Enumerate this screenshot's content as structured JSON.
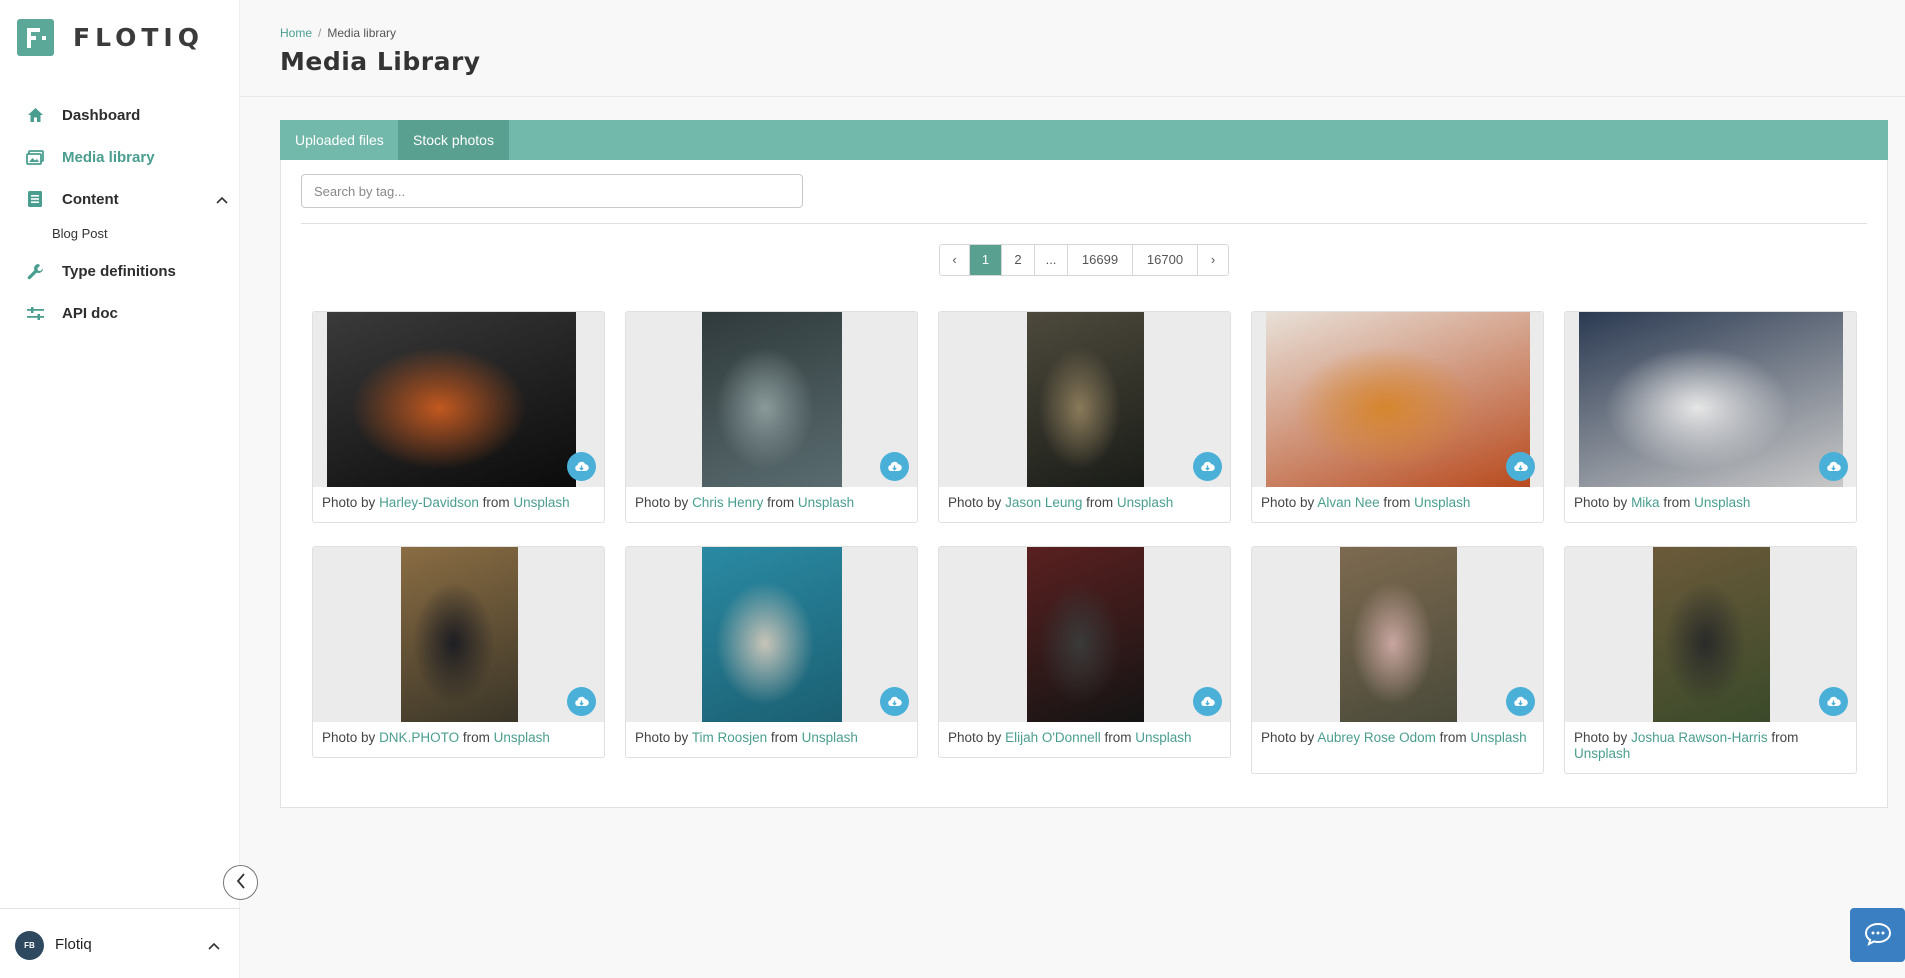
{
  "brand": {
    "name": "FLOTIQ",
    "accent": "#5ba899"
  },
  "sidebar": {
    "items": [
      {
        "label": "Dashboard",
        "icon": "home-icon"
      },
      {
        "label": "Media library",
        "icon": "image-icon"
      },
      {
        "label": "Content",
        "icon": "document-icon"
      },
      {
        "label": "Type definitions",
        "icon": "wrench-icon"
      },
      {
        "label": "API doc",
        "icon": "sliders-icon"
      }
    ],
    "sub_items": [
      {
        "label": "Blog Post"
      }
    ]
  },
  "user": {
    "initials": "FB",
    "name": "Flotiq"
  },
  "breadcrumb": {
    "home": "Home",
    "current": "Media library"
  },
  "page": {
    "title": "Media Library"
  },
  "tabs": [
    {
      "label": "Uploaded files"
    },
    {
      "label": "Stock photos"
    }
  ],
  "search": {
    "placeholder": "Search by tag...",
    "value": ""
  },
  "pagination": {
    "prev": "‹",
    "next": "›",
    "pages": [
      "1",
      "2",
      "...",
      "16699",
      "16700"
    ],
    "current": "1"
  },
  "photos": [
    {
      "prefix": "Photo by",
      "author": "Harley-Davidson",
      "from": "from",
      "source": "Unsplash",
      "palette": [
        "#0b0b0b",
        "#3a3a3a",
        "#c2581f"
      ]
    },
    {
      "prefix": "Photo by",
      "author": "Chris Henry",
      "from": "from",
      "source": "Unsplash",
      "palette": [
        "#5a6c70",
        "#2f3a3b",
        "#8a9a9b"
      ]
    },
    {
      "prefix": "Photo by",
      "author": "Jason Leung",
      "from": "from",
      "source": "Unsplash",
      "palette": [
        "#1a1c18",
        "#4d4a3c",
        "#8a7a5a"
      ]
    },
    {
      "prefix": "Photo by",
      "author": "Alvan Nee",
      "from": "from",
      "source": "Unsplash",
      "palette": [
        "#b84a1e",
        "#e8e0d8",
        "#d6862e"
      ]
    },
    {
      "prefix": "Photo by",
      "author": "Mika",
      "from": "from",
      "source": "Unsplash",
      "palette": [
        "#c9c9c9",
        "#2b3a52",
        "#e6e6e6"
      ]
    },
    {
      "prefix": "Photo by",
      "author": "DNK.PHOTO",
      "from": "from",
      "source": "Unsplash",
      "palette": [
        "#3a3528",
        "#8a6d43",
        "#1d1d22"
      ]
    },
    {
      "prefix": "Photo by",
      "author": "Tim Roosjen",
      "from": "from",
      "source": "Unsplash",
      "palette": [
        "#1b5f72",
        "#2a8aa3",
        "#c8c4b8"
      ]
    },
    {
      "prefix": "Photo by",
      "author": "Elijah O'Donnell",
      "from": "from",
      "source": "Unsplash",
      "palette": [
        "#141414",
        "#5a2020",
        "#3a3a3a"
      ]
    },
    {
      "prefix": "Photo by",
      "author": "Aubrey Rose Odom",
      "from": "from",
      "source": "Unsplash",
      "palette": [
        "#4a4a3a",
        "#7d6a50",
        "#c9a6a0"
      ]
    },
    {
      "prefix": "Photo by",
      "author": "Joshua Rawson-Harris",
      "from": "from",
      "source": "Unsplash",
      "palette": [
        "#3a4a2a",
        "#6b5a3a",
        "#2a2a2a"
      ]
    }
  ]
}
